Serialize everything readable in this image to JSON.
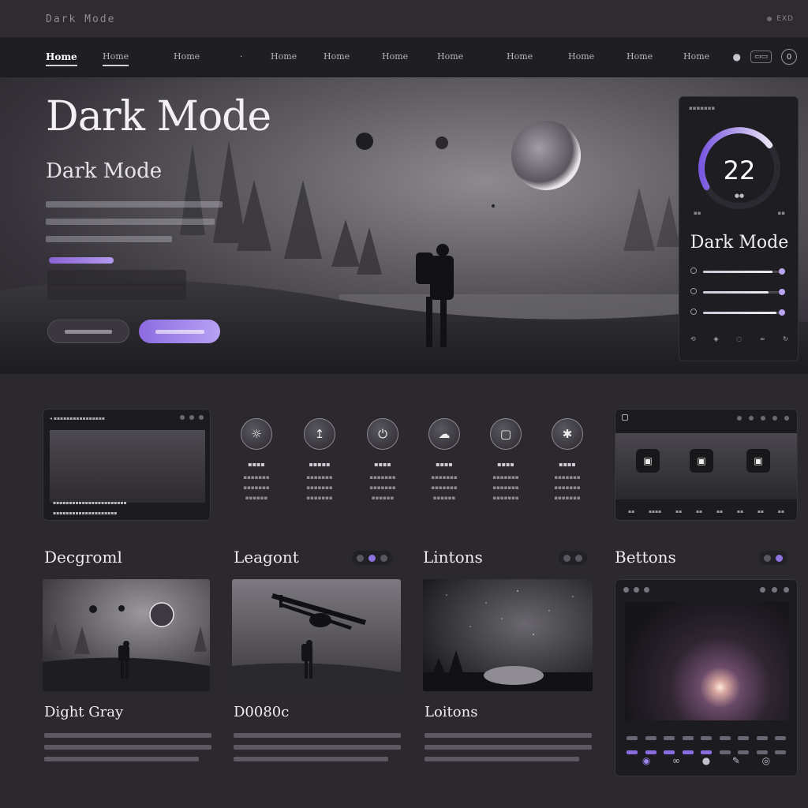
{
  "titlebar": {
    "brand": "Dark Mode",
    "meta": "EXD"
  },
  "nav": {
    "items": [
      {
        "label": "Home"
      },
      {
        "label": "Home"
      },
      {
        "label": "Home"
      },
      {
        "label": "Home"
      },
      {
        "label": "Home"
      },
      {
        "label": "Home"
      },
      {
        "label": "Home"
      },
      {
        "label": "Home"
      },
      {
        "label": "Home"
      },
      {
        "label": "Home"
      },
      {
        "label": "Home"
      }
    ],
    "badge": "0"
  },
  "hero": {
    "title": "Dark Mode",
    "subtitle": "Dark Mode",
    "primary_button": "",
    "secondary_button": ""
  },
  "side_panel": {
    "gauge_value": "22",
    "gauge_fraction": 0.72,
    "title": "Dark Mode",
    "sliders": [
      0.9,
      0.85,
      0.95
    ]
  },
  "icon_tiles": [
    {
      "icon": "sun-icon",
      "glyph": "☼"
    },
    {
      "icon": "share-icon",
      "glyph": "↥"
    },
    {
      "icon": "power-icon",
      "glyph": "⏻"
    },
    {
      "icon": "cloud-icon",
      "glyph": "☁"
    },
    {
      "icon": "chat-icon",
      "glyph": "▢"
    },
    {
      "icon": "settings-icon",
      "glyph": "✱"
    }
  ],
  "sections": [
    {
      "title": "Decgroml"
    },
    {
      "title": "Leagont"
    },
    {
      "title": "Lintons"
    },
    {
      "title": "Bettons"
    }
  ],
  "cards": [
    {
      "title": "Dight Gray"
    },
    {
      "title": "D0080c"
    },
    {
      "title": "Loitons"
    }
  ],
  "colors": {
    "accent": "#8c6be0",
    "background": "#2b292e",
    "navbar": "#1f1e22"
  }
}
